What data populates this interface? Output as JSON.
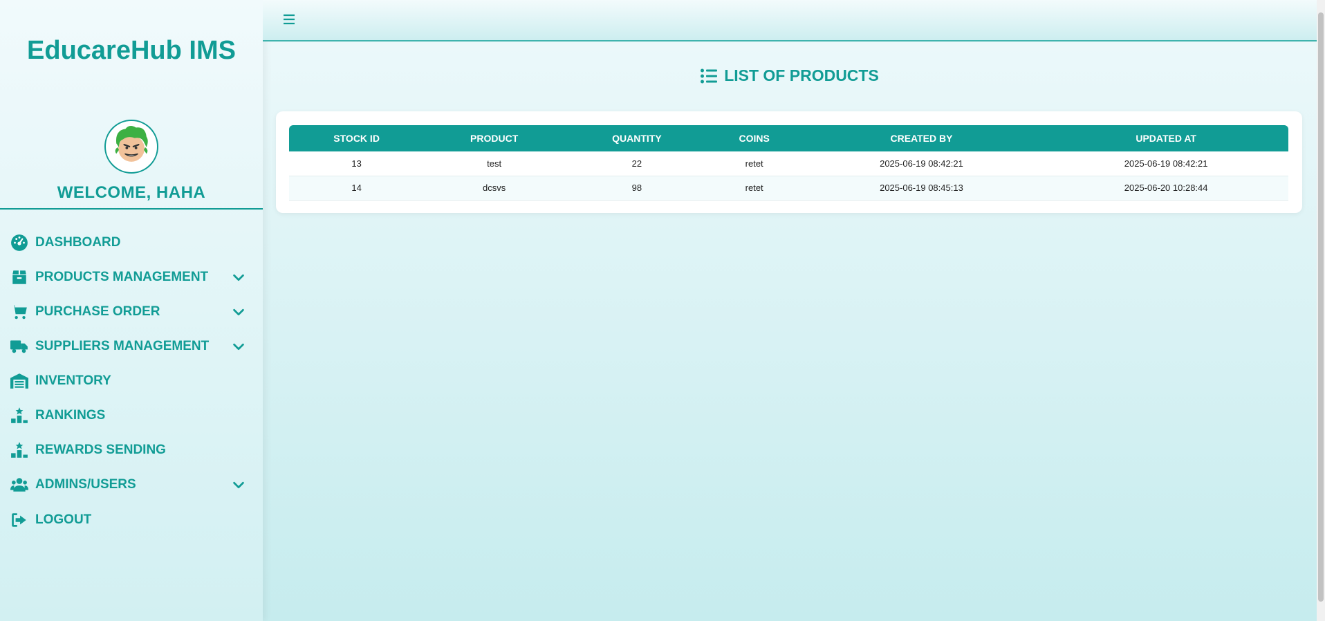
{
  "brand": "EducareHub IMS",
  "welcome": "WELCOME, HAHA",
  "nav": [
    {
      "label": "DASHBOARD",
      "icon": "gauge-icon",
      "expandable": false
    },
    {
      "label": "PRODUCTS MANAGEMENT",
      "icon": "box-icon",
      "expandable": true
    },
    {
      "label": "PURCHASE ORDER",
      "icon": "cart-icon",
      "expandable": true
    },
    {
      "label": "SUPPLIERS MANAGEMENT",
      "icon": "truck-icon",
      "expandable": true
    },
    {
      "label": "INVENTORY",
      "icon": "warehouse-icon",
      "expandable": false
    },
    {
      "label": "RANKINGS",
      "icon": "ranking-icon",
      "expandable": false
    },
    {
      "label": "REWARDS SENDING",
      "icon": "ranking-icon",
      "expandable": false
    },
    {
      "label": "ADMINS/USERS",
      "icon": "users-icon",
      "expandable": true
    },
    {
      "label": "LOGOUT",
      "icon": "logout-icon",
      "expandable": false
    }
  ],
  "page_title": "LIST OF PRODUCTS",
  "table": {
    "headers": [
      "STOCK ID",
      "PRODUCT",
      "QUANTITY",
      "COINS",
      "CREATED BY",
      "UPDATED AT"
    ],
    "rows": [
      [
        "13",
        "test",
        "22",
        "retet",
        "2025-06-19 08:42:21",
        "2025-06-19 08:42:21"
      ],
      [
        "14",
        "dcsvs",
        "98",
        "retet",
        "2025-06-19 08:45:13",
        "2025-06-20 10:28:44"
      ]
    ]
  },
  "colors": {
    "accent": "#119c95",
    "header_bg": "#119c95"
  }
}
